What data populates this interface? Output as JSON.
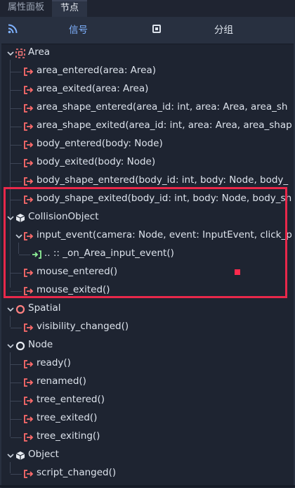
{
  "tabs": {
    "properties": "属性面板",
    "node": "节点"
  },
  "mode": {
    "signals": "信号",
    "groups": "分组"
  },
  "tree": {
    "area": {
      "label": "Area",
      "signals": [
        "area_entered(area: Area)",
        "area_exited(area: Area)",
        "area_shape_entered(area_id: int, area: Area, area_sh",
        "area_shape_exited(area_id: int, area: Area, area_shap",
        "body_entered(body: Node)",
        "body_exited(body: Node)",
        "body_shape_entered(body_id: int, body: Node, body_",
        "body_shape_exited(body_id: int, body: Node, body_sh"
      ]
    },
    "collision_object": {
      "label": "CollisionObject",
      "signals": [
        "input_event(camera: Node, event: InputEvent, click_p",
        "mouse_entered()",
        "mouse_exited()"
      ],
      "connection": ".. :: _on_Area_input_event()"
    },
    "spatial": {
      "label": "Spatial",
      "signals": [
        "visibility_changed()"
      ]
    },
    "node": {
      "label": "Node",
      "signals": [
        "ready()",
        "renamed()",
        "tree_entered()",
        "tree_exited()",
        "tree_exiting()"
      ]
    },
    "object": {
      "label": "Object",
      "signals": [
        "script_changed()"
      ]
    }
  },
  "colors": {
    "signal_icon": "#ff6b6b",
    "connection_icon": "#8eef97",
    "highlight": "#e8284a",
    "accent": "#7fb2ff"
  },
  "icons": {
    "signal": "signal-arrow-icon",
    "connection": "slot-connection-icon",
    "area": "area-icon",
    "collision_object": "cube-icon",
    "spatial": "spatial-circle-icon",
    "node": "node-circle-icon",
    "object": "cube-icon"
  }
}
